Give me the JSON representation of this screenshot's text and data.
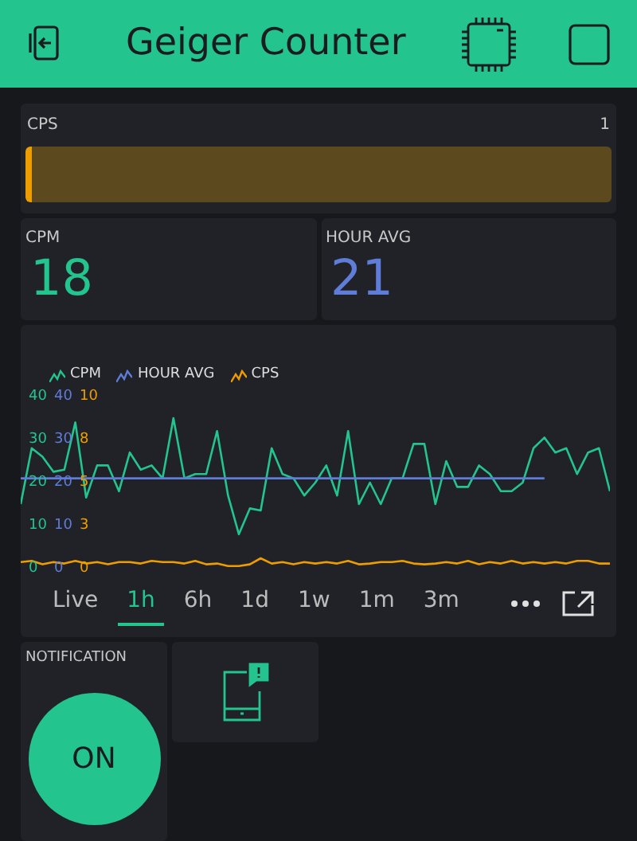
{
  "header": {
    "title": "Geiger Counter"
  },
  "cps_gauge": {
    "label": "CPS",
    "reading": "1",
    "level": 0.01,
    "color": "#ed9d00"
  },
  "value_cards": [
    {
      "label": "CPM",
      "value": "18",
      "color": "#23c48e"
    },
    {
      "label": "HOUR AVG",
      "value": "21",
      "color": "#5f7cd8"
    }
  ],
  "chart": {
    "y_axes": [
      {
        "color": "#5f7cd8",
        "ticks": [
          "40",
          "30",
          "20",
          "10",
          "0"
        ]
      },
      {
        "color": "#ed9d00",
        "ticks": [
          "10",
          "8",
          "5",
          "3",
          "0"
        ]
      }
    ],
    "chart_data": {
      "type": "line",
      "ylim": [
        -15.93,
        56.67
      ],
      "yticks": [
        {
          "value": 0,
          "label": "0"
        },
        {
          "value": 10,
          "label": "10"
        },
        {
          "value": 20,
          "label": "20"
        },
        {
          "value": 30,
          "label": "30"
        },
        {
          "value": 40,
          "label": "40"
        }
      ],
      "categories": [
        null,
        null,
        null,
        null,
        null,
        null,
        null,
        null,
        null,
        null,
        null,
        null,
        null,
        null,
        null,
        null,
        null,
        null,
        null,
        null,
        null,
        null,
        null,
        null,
        null,
        null,
        null,
        null,
        null,
        null,
        null,
        null,
        null,
        null,
        null,
        null,
        null,
        null,
        null,
        null,
        null,
        null,
        null,
        null,
        null,
        null,
        null,
        null,
        null,
        null,
        null,
        null,
        null,
        null,
        null
      ],
      "series": [
        {
          "name": "CPM",
          "color": "#23c48e",
          "values": [
            15,
            28,
            26,
            22.5,
            23,
            34,
            16.5,
            24,
            24,
            18,
            27,
            23,
            24,
            21,
            35,
            21,
            22,
            22,
            32,
            17,
            8,
            14,
            13.5,
            28,
            22,
            21,
            17,
            20,
            24,
            17,
            32,
            15,
            20,
            15,
            21,
            21,
            29,
            29,
            15,
            25,
            19,
            19,
            24,
            22,
            18,
            18,
            20,
            28,
            30.5,
            27,
            28,
            22,
            27,
            28,
            18
          ]
        },
        {
          "name": "HOUR AVG",
          "color": "#5f7cd8",
          "values": [
            21,
            21,
            21,
            21,
            21,
            21,
            21,
            21,
            21,
            21,
            21,
            21,
            21,
            21,
            21,
            21,
            21,
            21,
            21,
            21,
            21,
            21,
            21,
            21,
            21,
            21,
            21,
            21,
            21,
            21,
            21,
            21,
            21,
            21,
            21,
            21,
            21,
            21,
            21,
            21,
            21,
            21,
            21,
            21,
            21,
            21,
            21,
            21,
            21,
            null,
            null,
            null,
            null,
            null,
            null
          ]
        },
        {
          "name": "CPS",
          "color": "#ed9d00",
          "values": [
            1.5,
            1.8,
            1,
            1.5,
            1.2,
            1.8,
            1.2,
            1.5,
            1,
            1.5,
            1.5,
            1.2,
            1.8,
            1.5,
            1.5,
            1.2,
            1.8,
            1,
            1.2,
            0.6,
            0.6,
            1,
            2.4,
            1.2,
            1.5,
            1,
            1.5,
            1.2,
            1.5,
            1.2,
            1.8,
            1,
            1.2,
            1.5,
            1.5,
            1.8,
            1.2,
            1,
            1.2,
            1.5,
            1.2,
            1.8,
            1,
            1.5,
            1.2,
            1.8,
            1.2,
            1.5,
            1.2,
            1.5,
            1.2,
            1.8,
            1.8,
            1.2,
            1.2
          ]
        }
      ]
    },
    "ranges": [
      {
        "label": "Live",
        "selected": false
      },
      {
        "label": "1h",
        "selected": true
      },
      {
        "label": "6h",
        "selected": false
      },
      {
        "label": "1d",
        "selected": false
      },
      {
        "label": "1w",
        "selected": false
      },
      {
        "label": "1m",
        "selected": false
      },
      {
        "label": "3m",
        "selected": false
      }
    ]
  },
  "notification": {
    "label": "NOTIFICATION",
    "button": "ON",
    "on": true
  }
}
